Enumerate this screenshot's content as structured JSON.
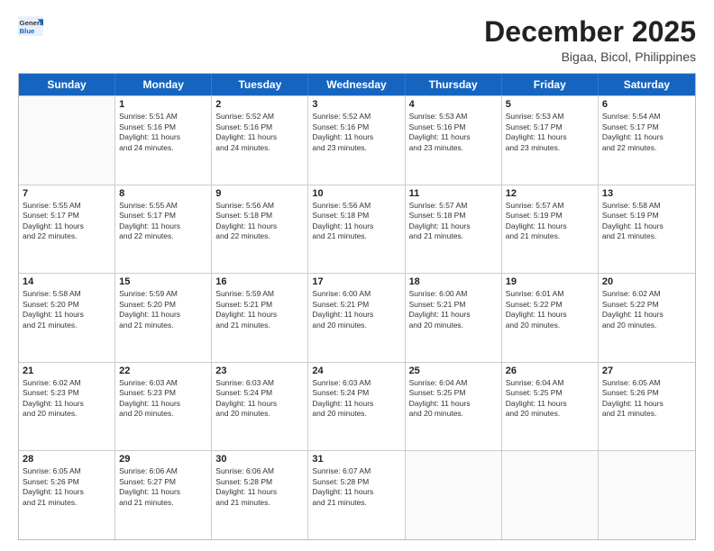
{
  "header": {
    "logo": {
      "general": "General",
      "blue": "Blue"
    },
    "title": "December 2025",
    "location": "Bigaa, Bicol, Philippines"
  },
  "days_of_week": [
    "Sunday",
    "Monday",
    "Tuesday",
    "Wednesday",
    "Thursday",
    "Friday",
    "Saturday"
  ],
  "rows": [
    [
      {
        "day": "",
        "info": ""
      },
      {
        "day": "1",
        "info": "Sunrise: 5:51 AM\nSunset: 5:16 PM\nDaylight: 11 hours\nand 24 minutes."
      },
      {
        "day": "2",
        "info": "Sunrise: 5:52 AM\nSunset: 5:16 PM\nDaylight: 11 hours\nand 24 minutes."
      },
      {
        "day": "3",
        "info": "Sunrise: 5:52 AM\nSunset: 5:16 PM\nDaylight: 11 hours\nand 23 minutes."
      },
      {
        "day": "4",
        "info": "Sunrise: 5:53 AM\nSunset: 5:16 PM\nDaylight: 11 hours\nand 23 minutes."
      },
      {
        "day": "5",
        "info": "Sunrise: 5:53 AM\nSunset: 5:17 PM\nDaylight: 11 hours\nand 23 minutes."
      },
      {
        "day": "6",
        "info": "Sunrise: 5:54 AM\nSunset: 5:17 PM\nDaylight: 11 hours\nand 22 minutes."
      }
    ],
    [
      {
        "day": "7",
        "info": "Sunrise: 5:55 AM\nSunset: 5:17 PM\nDaylight: 11 hours\nand 22 minutes."
      },
      {
        "day": "8",
        "info": "Sunrise: 5:55 AM\nSunset: 5:17 PM\nDaylight: 11 hours\nand 22 minutes."
      },
      {
        "day": "9",
        "info": "Sunrise: 5:56 AM\nSunset: 5:18 PM\nDaylight: 11 hours\nand 22 minutes."
      },
      {
        "day": "10",
        "info": "Sunrise: 5:56 AM\nSunset: 5:18 PM\nDaylight: 11 hours\nand 21 minutes."
      },
      {
        "day": "11",
        "info": "Sunrise: 5:57 AM\nSunset: 5:18 PM\nDaylight: 11 hours\nand 21 minutes."
      },
      {
        "day": "12",
        "info": "Sunrise: 5:57 AM\nSunset: 5:19 PM\nDaylight: 11 hours\nand 21 minutes."
      },
      {
        "day": "13",
        "info": "Sunrise: 5:58 AM\nSunset: 5:19 PM\nDaylight: 11 hours\nand 21 minutes."
      }
    ],
    [
      {
        "day": "14",
        "info": "Sunrise: 5:58 AM\nSunset: 5:20 PM\nDaylight: 11 hours\nand 21 minutes."
      },
      {
        "day": "15",
        "info": "Sunrise: 5:59 AM\nSunset: 5:20 PM\nDaylight: 11 hours\nand 21 minutes."
      },
      {
        "day": "16",
        "info": "Sunrise: 5:59 AM\nSunset: 5:21 PM\nDaylight: 11 hours\nand 21 minutes."
      },
      {
        "day": "17",
        "info": "Sunrise: 6:00 AM\nSunset: 5:21 PM\nDaylight: 11 hours\nand 20 minutes."
      },
      {
        "day": "18",
        "info": "Sunrise: 6:00 AM\nSunset: 5:21 PM\nDaylight: 11 hours\nand 20 minutes."
      },
      {
        "day": "19",
        "info": "Sunrise: 6:01 AM\nSunset: 5:22 PM\nDaylight: 11 hours\nand 20 minutes."
      },
      {
        "day": "20",
        "info": "Sunrise: 6:02 AM\nSunset: 5:22 PM\nDaylight: 11 hours\nand 20 minutes."
      }
    ],
    [
      {
        "day": "21",
        "info": "Sunrise: 6:02 AM\nSunset: 5:23 PM\nDaylight: 11 hours\nand 20 minutes."
      },
      {
        "day": "22",
        "info": "Sunrise: 6:03 AM\nSunset: 5:23 PM\nDaylight: 11 hours\nand 20 minutes."
      },
      {
        "day": "23",
        "info": "Sunrise: 6:03 AM\nSunset: 5:24 PM\nDaylight: 11 hours\nand 20 minutes."
      },
      {
        "day": "24",
        "info": "Sunrise: 6:03 AM\nSunset: 5:24 PM\nDaylight: 11 hours\nand 20 minutes."
      },
      {
        "day": "25",
        "info": "Sunrise: 6:04 AM\nSunset: 5:25 PM\nDaylight: 11 hours\nand 20 minutes."
      },
      {
        "day": "26",
        "info": "Sunrise: 6:04 AM\nSunset: 5:25 PM\nDaylight: 11 hours\nand 20 minutes."
      },
      {
        "day": "27",
        "info": "Sunrise: 6:05 AM\nSunset: 5:26 PM\nDaylight: 11 hours\nand 21 minutes."
      }
    ],
    [
      {
        "day": "28",
        "info": "Sunrise: 6:05 AM\nSunset: 5:26 PM\nDaylight: 11 hours\nand 21 minutes."
      },
      {
        "day": "29",
        "info": "Sunrise: 6:06 AM\nSunset: 5:27 PM\nDaylight: 11 hours\nand 21 minutes."
      },
      {
        "day": "30",
        "info": "Sunrise: 6:06 AM\nSunset: 5:28 PM\nDaylight: 11 hours\nand 21 minutes."
      },
      {
        "day": "31",
        "info": "Sunrise: 6:07 AM\nSunset: 5:28 PM\nDaylight: 11 hours\nand 21 minutes."
      },
      {
        "day": "",
        "info": ""
      },
      {
        "day": "",
        "info": ""
      },
      {
        "day": "",
        "info": ""
      }
    ]
  ]
}
